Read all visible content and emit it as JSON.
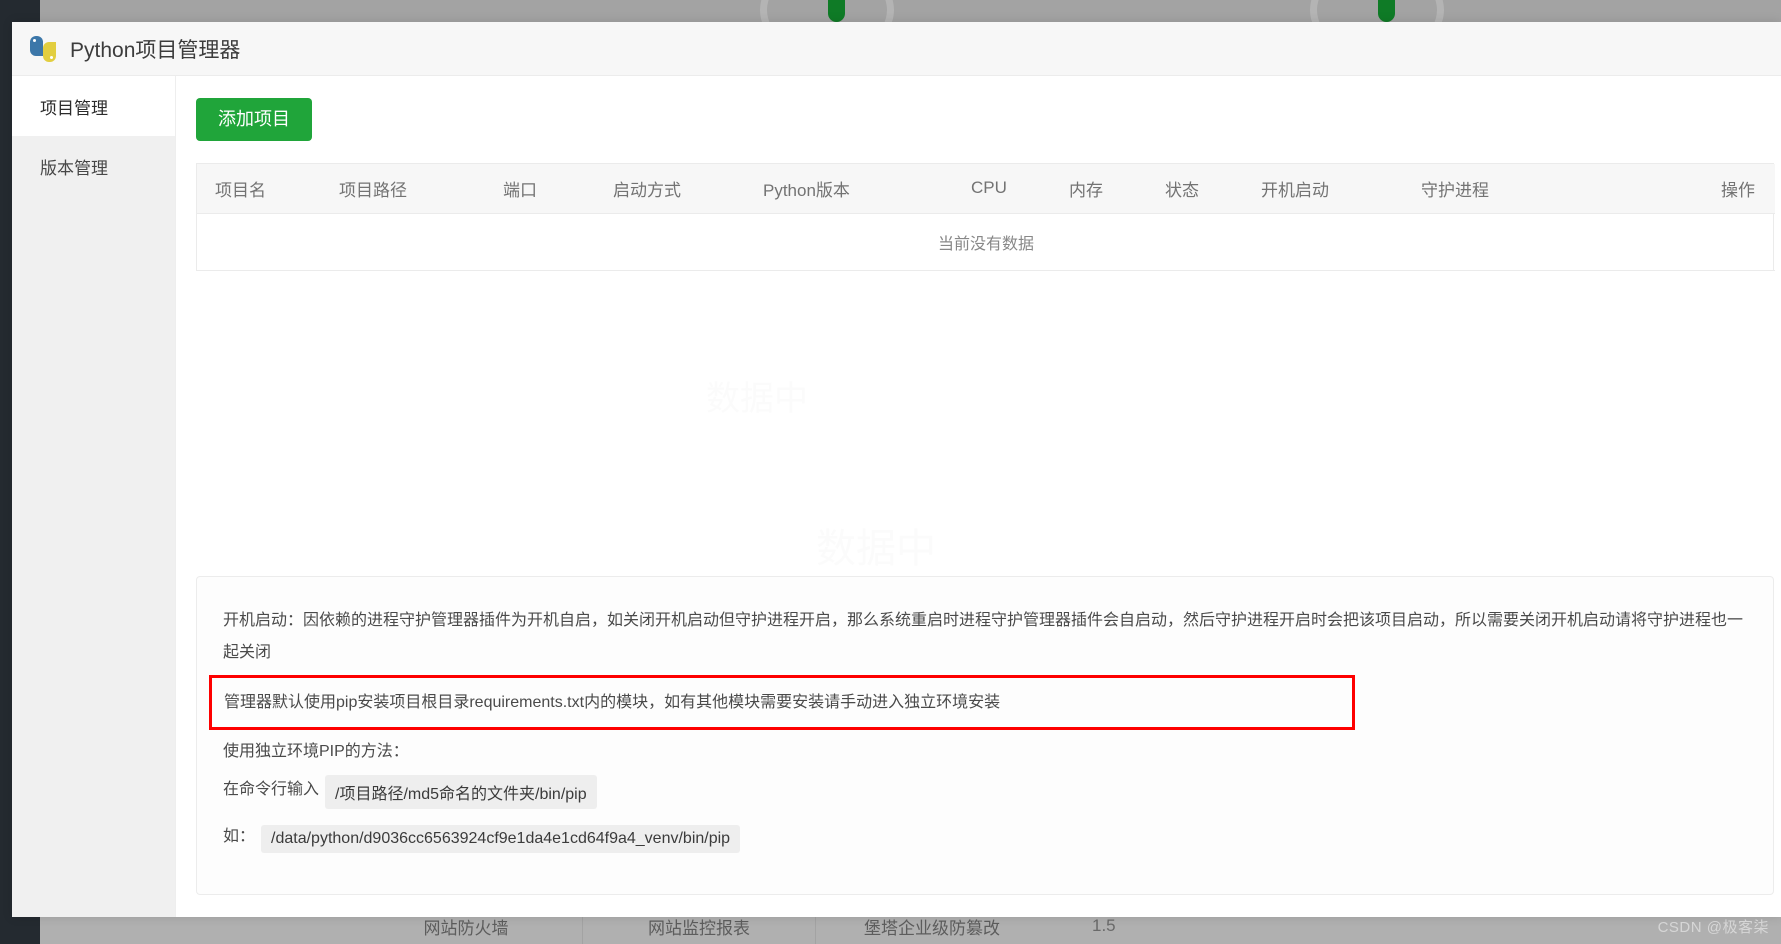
{
  "window": {
    "title": "Python项目管理器",
    "logo_icon": "python-logo-icon"
  },
  "sidebar": {
    "items": [
      {
        "label": "项目管理",
        "active": true
      },
      {
        "label": "版本管理",
        "active": false
      }
    ]
  },
  "toolbar": {
    "add_project_label": "添加项目",
    "accent_color": "#20a53a"
  },
  "table": {
    "columns": [
      "项目名",
      "项目路径",
      "端口",
      "启动方式",
      "Python版本",
      "CPU",
      "内存",
      "状态",
      "开机启动",
      "守护进程",
      "操作"
    ],
    "empty_text": "当前没有数据",
    "rows": []
  },
  "notes": {
    "line1": "开机启动：因依赖的进程守护管理器插件为开机自启，如关闭开机启动但守护进程开启，那么系统重启时进程守护管理器插件会自启动，然后守护进程开启时会把该项目启动，所以需要关闭开机启动请将守护进程也一起关闭",
    "highlighted": "管理器默认使用pip安装项目根目录requirements.txt内的模块，如有其他模块需要安装请手动进入独立环境安装",
    "highlight_color": "#fe0000",
    "line3": "使用独立环境PIP的方法：",
    "line4_label": "在命令行输入",
    "line4_code": "/项目路径/md5命名的文件夹/bin/pip",
    "line5_label": "如：",
    "line5_code": "/data/python/d9036cc6563924cf9e1da4e1cd64f9a4_venv/bin/pip"
  },
  "background": {
    "bottom_bar_items": [
      "网站防火墙",
      "网站监控报表",
      "堡塔企业级防篡改"
    ],
    "version_text": "1.5",
    "body_watermark": "数据中"
  },
  "watermark": {
    "text": "CSDN @极客柒"
  }
}
